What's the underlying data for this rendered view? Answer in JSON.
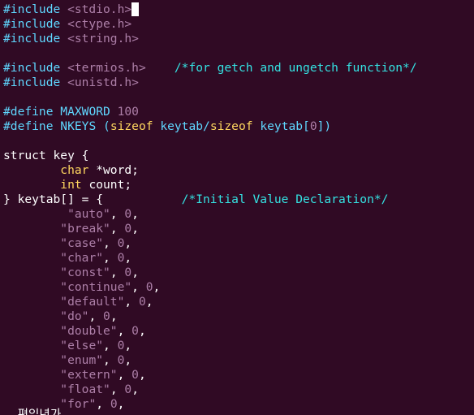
{
  "colors": {
    "background": "#300a24",
    "preprocessor": "#5fd7ff",
    "header": "#ad7fa8",
    "comment": "#34e2e2",
    "keyword_type": "#ffd75f",
    "string": "#ad7fa8",
    "text": "#ffffff",
    "cursor": "#ffffff"
  },
  "editor": {
    "lines": [
      [
        {
          "t": "#include ",
          "c": "preprocessor"
        },
        {
          "t": "<stdio.h>",
          "c": "header"
        },
        {
          "cursor": true
        }
      ],
      [
        {
          "t": "#include ",
          "c": "preprocessor"
        },
        {
          "t": "<ctype.h>",
          "c": "header"
        }
      ],
      [
        {
          "t": "#include ",
          "c": "preprocessor"
        },
        {
          "t": "<string.h>",
          "c": "header"
        }
      ],
      [],
      [
        {
          "t": "#include ",
          "c": "preprocessor"
        },
        {
          "t": "<termios.h>",
          "c": "header"
        },
        {
          "t": "    ",
          "c": "text"
        },
        {
          "t": "/*for getch and ungetch function*/",
          "c": "comment"
        }
      ],
      [
        {
          "t": "#include ",
          "c": "preprocessor"
        },
        {
          "t": "<unistd.h>",
          "c": "header"
        }
      ],
      [],
      [
        {
          "t": "#define ",
          "c": "preprocessor"
        },
        {
          "t": "MAXWORD ",
          "c": "preprocessor"
        },
        {
          "t": "100",
          "c": "header"
        }
      ],
      [
        {
          "t": "#define ",
          "c": "preprocessor"
        },
        {
          "t": "NKEYS (",
          "c": "preprocessor"
        },
        {
          "t": "sizeof",
          "c": "keyword_type"
        },
        {
          "t": " keytab/",
          "c": "preprocessor"
        },
        {
          "t": "sizeof",
          "c": "keyword_type"
        },
        {
          "t": " keytab[",
          "c": "preprocessor"
        },
        {
          "t": "0",
          "c": "header"
        },
        {
          "t": "])",
          "c": "preprocessor"
        }
      ],
      [],
      [
        {
          "t": "struct key {",
          "c": "text"
        }
      ],
      [
        {
          "t": "        ",
          "c": "text"
        },
        {
          "t": "char",
          "c": "keyword_type"
        },
        {
          "t": " *word;",
          "c": "text"
        }
      ],
      [
        {
          "t": "        ",
          "c": "text"
        },
        {
          "t": "int",
          "c": "keyword_type"
        },
        {
          "t": " count;",
          "c": "text"
        }
      ],
      [
        {
          "t": "} keytab[] = {           ",
          "c": "text"
        },
        {
          "t": "/*Initial Value Declaration*/",
          "c": "comment"
        }
      ],
      [
        {
          "t": "         ",
          "c": "text"
        },
        {
          "t": "\"auto\"",
          "c": "string"
        },
        {
          "t": ", ",
          "c": "text"
        },
        {
          "t": "0",
          "c": "string"
        },
        {
          "t": ",",
          "c": "text"
        }
      ],
      [
        {
          "t": "        ",
          "c": "text"
        },
        {
          "t": "\"break\"",
          "c": "string"
        },
        {
          "t": ", ",
          "c": "text"
        },
        {
          "t": "0",
          "c": "string"
        },
        {
          "t": ",",
          "c": "text"
        }
      ],
      [
        {
          "t": "        ",
          "c": "text"
        },
        {
          "t": "\"case\"",
          "c": "string"
        },
        {
          "t": ", ",
          "c": "text"
        },
        {
          "t": "0",
          "c": "string"
        },
        {
          "t": ",",
          "c": "text"
        }
      ],
      [
        {
          "t": "        ",
          "c": "text"
        },
        {
          "t": "\"char\"",
          "c": "string"
        },
        {
          "t": ", ",
          "c": "text"
        },
        {
          "t": "0",
          "c": "string"
        },
        {
          "t": ",",
          "c": "text"
        }
      ],
      [
        {
          "t": "        ",
          "c": "text"
        },
        {
          "t": "\"const\"",
          "c": "string"
        },
        {
          "t": ", ",
          "c": "text"
        },
        {
          "t": "0",
          "c": "string"
        },
        {
          "t": ",",
          "c": "text"
        }
      ],
      [
        {
          "t": "        ",
          "c": "text"
        },
        {
          "t": "\"continue\"",
          "c": "string"
        },
        {
          "t": ", ",
          "c": "text"
        },
        {
          "t": "0",
          "c": "string"
        },
        {
          "t": ",",
          "c": "text"
        }
      ],
      [
        {
          "t": "        ",
          "c": "text"
        },
        {
          "t": "\"default\"",
          "c": "string"
        },
        {
          "t": ", ",
          "c": "text"
        },
        {
          "t": "0",
          "c": "string"
        },
        {
          "t": ",",
          "c": "text"
        }
      ],
      [
        {
          "t": "        ",
          "c": "text"
        },
        {
          "t": "\"do\"",
          "c": "string"
        },
        {
          "t": ", ",
          "c": "text"
        },
        {
          "t": "0",
          "c": "string"
        },
        {
          "t": ",",
          "c": "text"
        }
      ],
      [
        {
          "t": "        ",
          "c": "text"
        },
        {
          "t": "\"double\"",
          "c": "string"
        },
        {
          "t": ", ",
          "c": "text"
        },
        {
          "t": "0",
          "c": "string"
        },
        {
          "t": ",",
          "c": "text"
        }
      ],
      [
        {
          "t": "        ",
          "c": "text"
        },
        {
          "t": "\"else\"",
          "c": "string"
        },
        {
          "t": ", ",
          "c": "text"
        },
        {
          "t": "0",
          "c": "string"
        },
        {
          "t": ",",
          "c": "text"
        }
      ],
      [
        {
          "t": "        ",
          "c": "text"
        },
        {
          "t": "\"enum\"",
          "c": "string"
        },
        {
          "t": ", ",
          "c": "text"
        },
        {
          "t": "0",
          "c": "string"
        },
        {
          "t": ",",
          "c": "text"
        }
      ],
      [
        {
          "t": "        ",
          "c": "text"
        },
        {
          "t": "\"extern\"",
          "c": "string"
        },
        {
          "t": ", ",
          "c": "text"
        },
        {
          "t": "0",
          "c": "string"
        },
        {
          "t": ",",
          "c": "text"
        }
      ],
      [
        {
          "t": "        ",
          "c": "text"
        },
        {
          "t": "\"float\"",
          "c": "string"
        },
        {
          "t": ", ",
          "c": "text"
        },
        {
          "t": "0",
          "c": "string"
        },
        {
          "t": ",",
          "c": "text"
        }
      ],
      [
        {
          "t": "        ",
          "c": "text"
        },
        {
          "t": "\"for\"",
          "c": "string"
        },
        {
          "t": ", ",
          "c": "text"
        },
        {
          "t": "0",
          "c": "string"
        },
        {
          "t": ",",
          "c": "text"
        }
      ]
    ],
    "status_text": "  편입년가"
  }
}
